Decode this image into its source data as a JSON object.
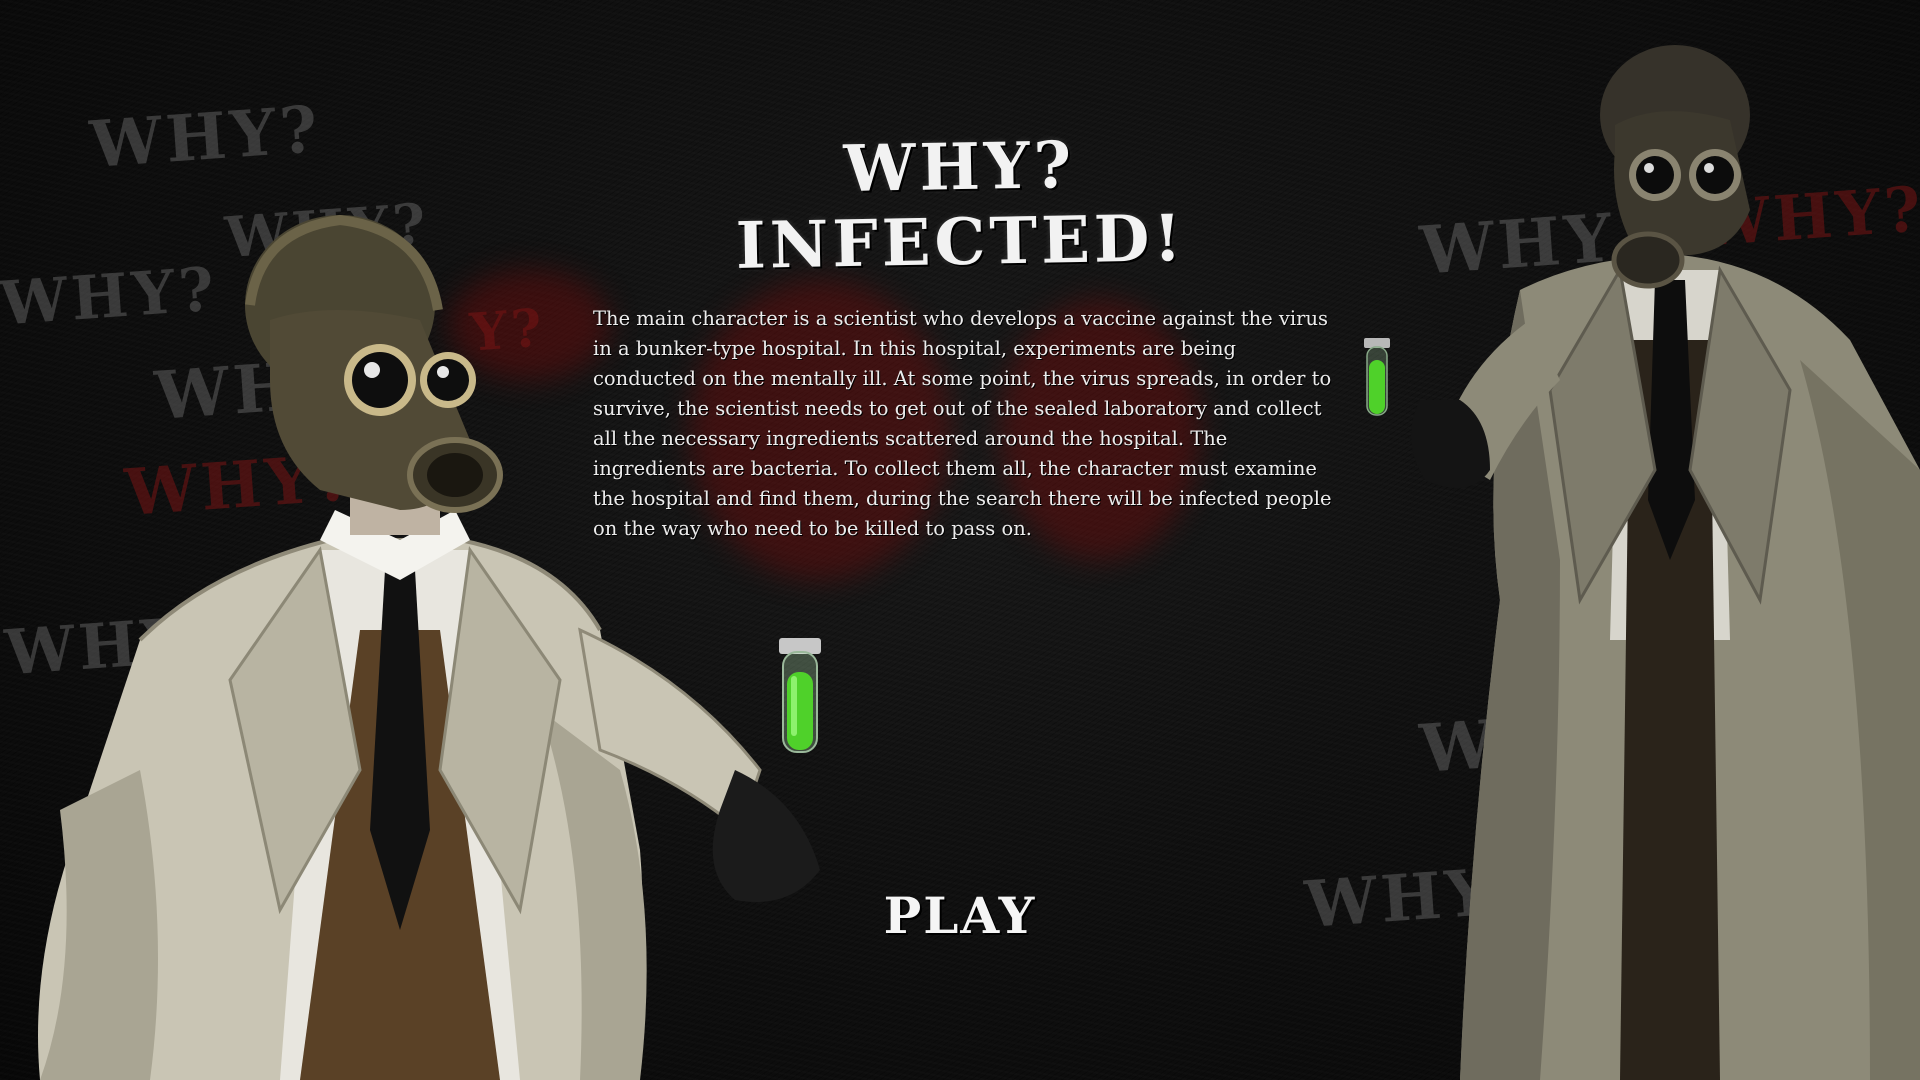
{
  "title": "WHY? INFECTED!",
  "story": "The main character is a scientist who develops a vaccine against the virus in a bunker-type hospital. In this hospital, experiments are being conducted on the mentally ill. At some point, the virus spreads, in order to survive, the scientist needs to get out of the sealed laboratory and collect all the necessary ingredients scattered around the hospital. The ingredients are bacteria. To collect them all, the character must examine the hospital and find them, during the search there will be infected people on the way who need to be killed to pass on.",
  "play_label": "PLAY",
  "background_words": [
    "WHY?",
    "WHY?",
    "WHY?",
    "WH",
    "WHY?",
    "WHY",
    "WHY",
    "WHY?",
    "WH",
    "WHY?",
    "Y?"
  ],
  "colors": {
    "background": "#0b0b0b",
    "text": "#ececec",
    "vial_green": "#4fd12a",
    "blood_red": "#6e0a0a",
    "graffiti_gray": "#8c8c8c"
  },
  "icons": [
    "scientist-character-left",
    "scientist-character-right",
    "green-vial-icon"
  ]
}
